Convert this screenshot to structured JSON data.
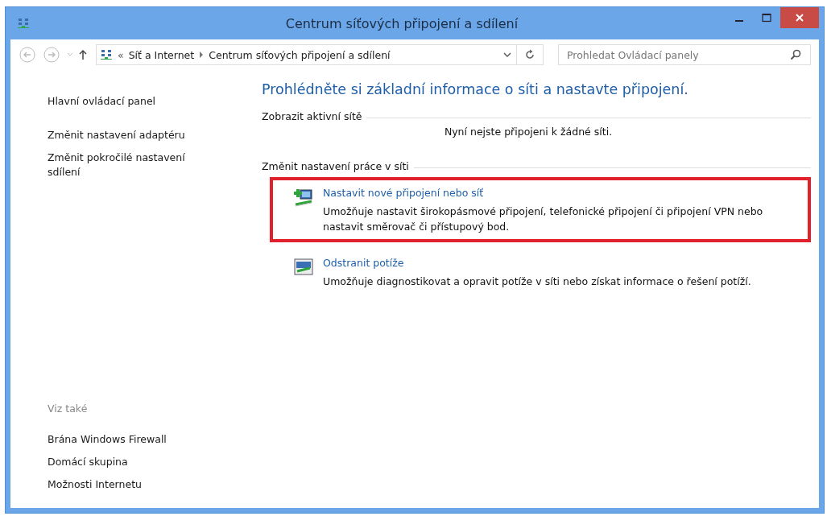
{
  "window": {
    "title": "Centrum síťových připojení a sdílení"
  },
  "address_bar": {
    "separator": "«",
    "crumbs": [
      {
        "label": "Síť a Internet"
      },
      {
        "label": "Centrum síťových připojení a sdílení"
      }
    ]
  },
  "search": {
    "placeholder": "Prohledat Ovládací panely"
  },
  "sidebar": {
    "items": [
      {
        "label": "Hlavní ovládací panel"
      },
      {
        "label": "Změnit nastavení adaptéru"
      },
      {
        "label": "Změnit pokročilé nastavení sdílení"
      }
    ],
    "see_also": {
      "heading": "Viz také",
      "items": [
        {
          "label": "Brána Windows Firewall"
        },
        {
          "label": "Domácí skupina"
        },
        {
          "label": "Možnosti Internetu"
        }
      ]
    }
  },
  "main": {
    "heading": "Prohlédněte si základní informace o síti a nastavte připojení.",
    "active_networks": {
      "heading": "Zobrazit aktivní sítě",
      "message": "Nyní nejste připojeni k žádné síti."
    },
    "change_settings": {
      "heading": "Změnit nastavení práce v síti",
      "tasks": [
        {
          "kind": "new-connection",
          "title": "Nastavit nové připojení nebo síť",
          "description": "Umožňuje nastavit širokopásmové připojení, telefonické připojení či připojení VPN nebo nastavit směrovač či přístupový bod.",
          "highlighted": true
        },
        {
          "kind": "troubleshoot",
          "title": "Odstranit potíže",
          "description": "Umožňuje diagnostikovat a opravit potíže v síti nebo získat informace o řešení potíží.",
          "highlighted": false
        }
      ]
    }
  }
}
